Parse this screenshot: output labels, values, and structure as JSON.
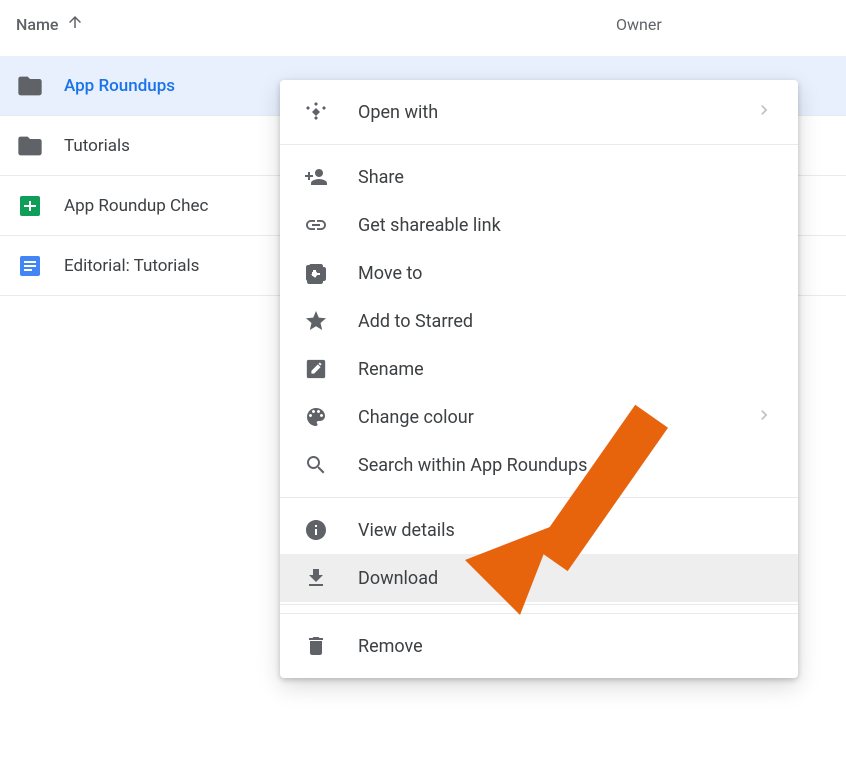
{
  "header": {
    "name_col": "Name",
    "owner_col": "Owner"
  },
  "files": [
    {
      "name": "App Roundups",
      "type": "folder",
      "selected": true
    },
    {
      "name": "Tutorials",
      "type": "folder",
      "selected": false
    },
    {
      "name": "App Roundup Chec",
      "type": "sheets",
      "selected": false
    },
    {
      "name": "Editorial: Tutorials",
      "type": "docs",
      "selected": false
    }
  ],
  "menu": {
    "open_with": "Open with",
    "share": "Share",
    "get_link": "Get shareable link",
    "move_to": "Move to",
    "add_starred": "Add to Starred",
    "rename": "Rename",
    "change_colour": "Change colour",
    "search_within": "Search within App Roundups",
    "view_details": "View details",
    "download": "Download",
    "remove": "Remove"
  }
}
